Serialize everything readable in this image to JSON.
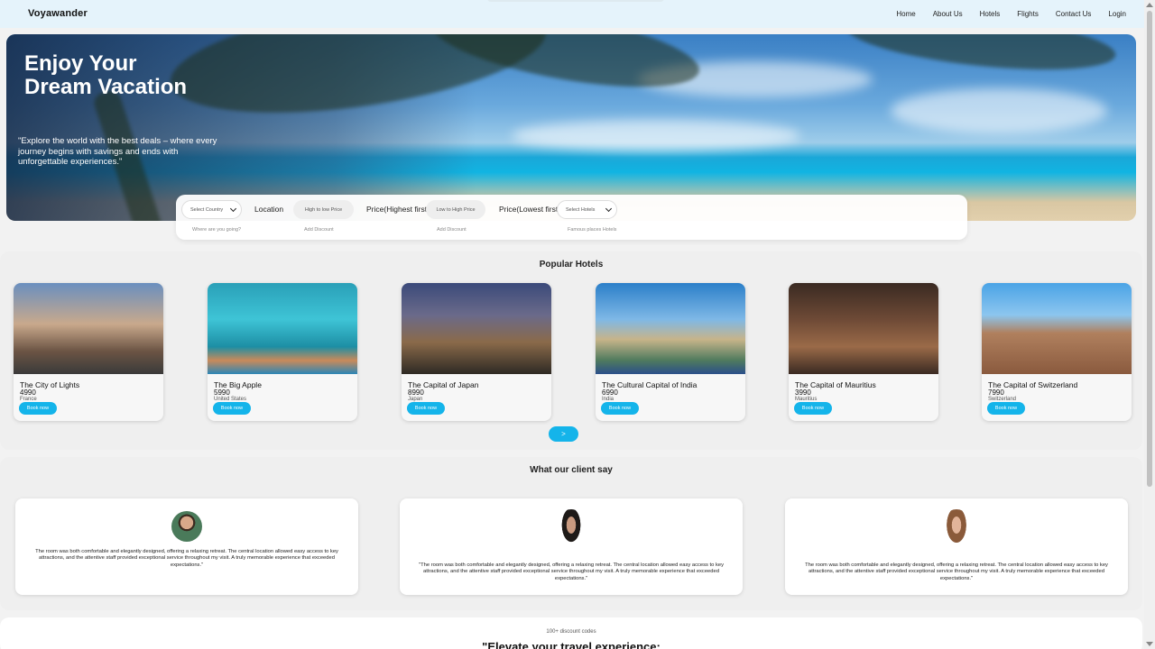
{
  "nav": {
    "brand": "Voyawander",
    "links": [
      "Home",
      "About Us",
      "Hotels",
      "Flights",
      "Contact Us",
      "Login"
    ]
  },
  "hero": {
    "title_line1": "Enjoy Your",
    "title_line2": "Dream Vacation",
    "quote": "\"Explore the world with the best deals – where every journey begins with savings and ends with unforgettable experiences.\""
  },
  "search": {
    "country_select": "Select Country",
    "country_hint": "Where are you going?",
    "location_label": "Location",
    "high_to_low": "High to low Price",
    "high_hint": "Add Discount",
    "price_high_label": "Price(Highest first)",
    "low_to_high": "Low to High Price",
    "low_hint": "Add Discount",
    "price_low_label": "Price(Lowest first)",
    "hotels_select": "Select Hotels",
    "hotels_hint": "Famous places Hotels"
  },
  "popular": {
    "heading": "Popular Hotels",
    "next_label": ">",
    "book_label": "Book now",
    "hotels": [
      {
        "name": "The City of Lights",
        "price": "4990",
        "country": "France"
      },
      {
        "name": "The Big Apple",
        "price": "5990",
        "country": "United States"
      },
      {
        "name": "The Capital of Japan",
        "price": "8990",
        "country": "Japan"
      },
      {
        "name": "The Cultural Capital of India",
        "price": "6990",
        "country": "India"
      },
      {
        "name": "The Capital of Mauritius",
        "price": "3990",
        "country": "Mauritius"
      },
      {
        "name": "The Capital of Switzerland",
        "price": "7990",
        "country": "Switzerland"
      }
    ]
  },
  "clients": {
    "heading": "What our client say",
    "testimonials": [
      {
        "text": "The room was both comfortable and elegantly designed, offering a relaxing retreat. The central location allowed easy access to key attractions, and the attentive staff provided exceptional service throughout my visit. A truly memorable experience that exceeded expectations.\""
      },
      {
        "text": "\"The room was both comfortable and elegantly designed, offering a relaxing retreat. The central location allowed easy access to key attractions, and the attentive staff provided exceptional service throughout my visit. A truly memorable experience that exceeded expectations.\""
      },
      {
        "text": "The room was both comfortable and elegantly designed, offering a relaxing retreat. The central location allowed easy access to key attractions, and the attentive staff provided exceptional service throughout my visit. A truly memorable experience that exceeded expectations.\""
      }
    ]
  },
  "discount": {
    "small": "100+ discount codes",
    "big": "\"Elevate your travel experience:"
  }
}
